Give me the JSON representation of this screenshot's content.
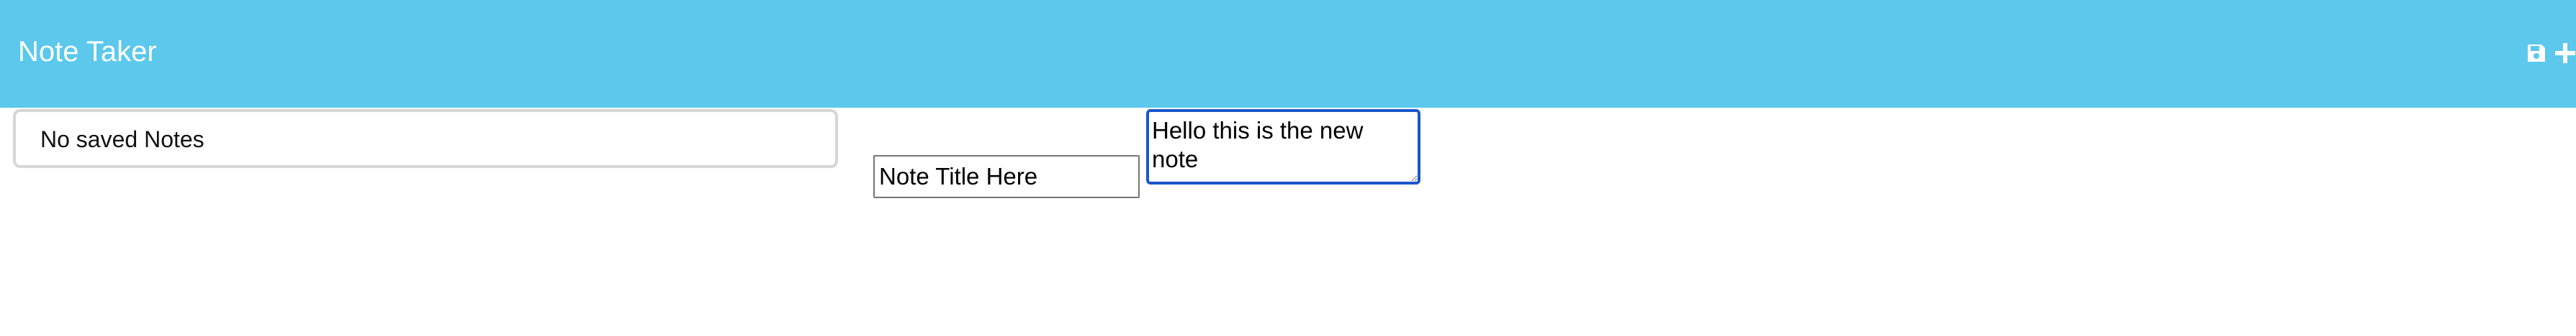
{
  "navbar": {
    "title": "Note Taker",
    "background_color": "#5bc8ec",
    "icons": [
      "save-icon",
      "plus-icon"
    ]
  },
  "notes_list": {
    "empty_message": "No saved Notes"
  },
  "editor": {
    "title_value": "Note Title Here",
    "text_value": "Hello this is the new note",
    "focus_color": "#1a56c9"
  }
}
